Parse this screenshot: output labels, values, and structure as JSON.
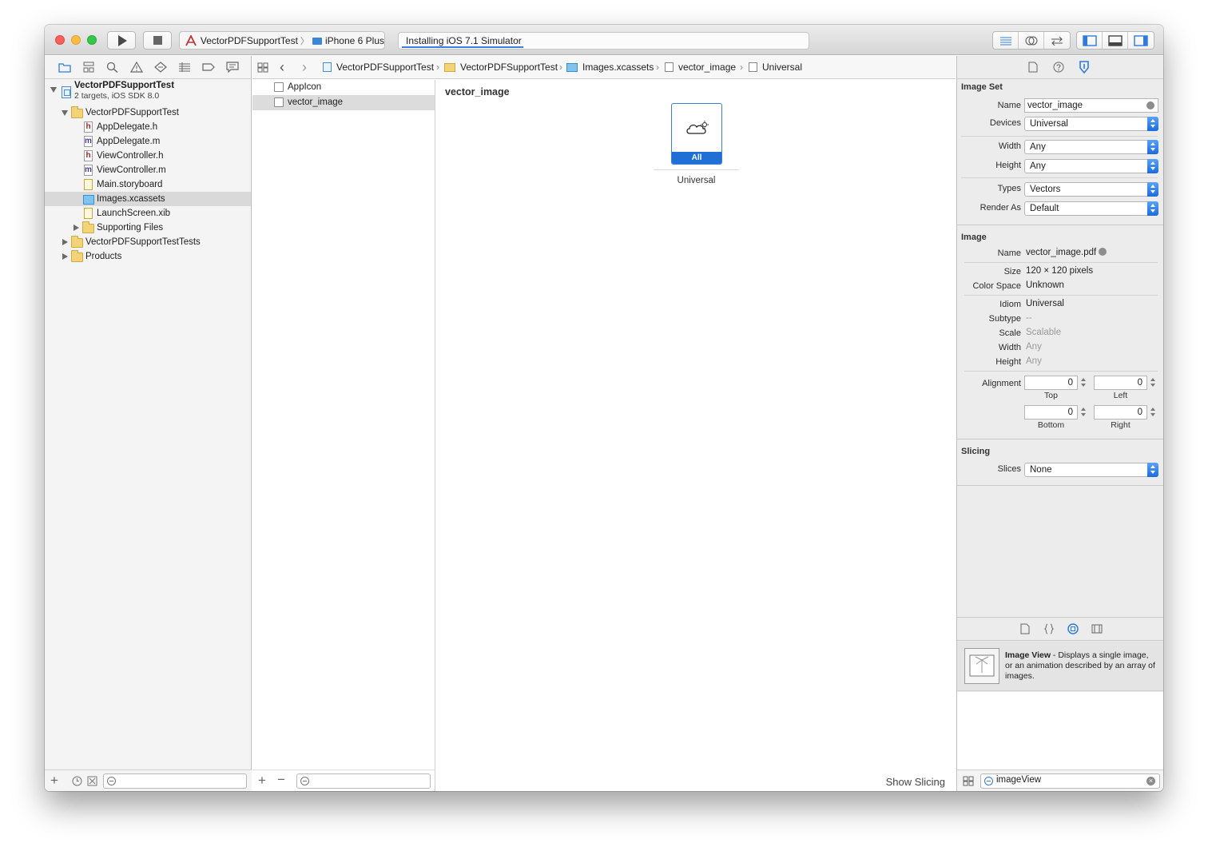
{
  "toolbar": {
    "scheme": "VectorPDFSupportTest",
    "device": "iPhone 6 Plus",
    "activity": "Installing iOS 7.1 Simulator"
  },
  "navigator": {
    "project": {
      "name": "VectorPDFSupportTest",
      "subtitle": "2 targets, iOS SDK 8.0"
    },
    "items": [
      {
        "label": "VectorPDFSupportTest",
        "kind": "folder"
      },
      {
        "label": "AppDelegate.h",
        "kind": "h"
      },
      {
        "label": "AppDelegate.m",
        "kind": "m"
      },
      {
        "label": "ViewController.h",
        "kind": "h"
      },
      {
        "label": "ViewController.m",
        "kind": "m"
      },
      {
        "label": "Main.storyboard",
        "kind": "storyboard"
      },
      {
        "label": "Images.xcassets",
        "kind": "xcassets",
        "selected": true
      },
      {
        "label": "LaunchScreen.xib",
        "kind": "xib"
      },
      {
        "label": "Supporting Files",
        "kind": "folder"
      },
      {
        "label": "VectorPDFSupportTestTests",
        "kind": "folder"
      },
      {
        "label": "Products",
        "kind": "folder"
      }
    ],
    "file_type_glyphs": {
      "h": "h",
      "m": "m"
    }
  },
  "jumpbar": {
    "crumbs": [
      "VectorPDFSupportTest",
      "VectorPDFSupportTest",
      "Images.xcassets",
      "vector_image",
      "Universal"
    ]
  },
  "assets": {
    "items": [
      {
        "label": "AppIcon"
      },
      {
        "label": "vector_image",
        "selected": true
      }
    ]
  },
  "canvas": {
    "title": "vector_image",
    "slot_label": "All",
    "slot_caption": "Universal",
    "show_slicing": "Show Slicing"
  },
  "inspector": {
    "image_set": {
      "title": "Image Set",
      "name_label": "Name",
      "name_value": "vector_image",
      "devices_label": "Devices",
      "devices_value": "Universal",
      "width_label": "Width",
      "width_value": "Any",
      "height_label": "Height",
      "height_value": "Any",
      "types_label": "Types",
      "types_value": "Vectors",
      "render_label": "Render As",
      "render_value": "Default"
    },
    "image": {
      "title": "Image",
      "name_label": "Name",
      "name_value": "vector_image.pdf",
      "size_label": "Size",
      "size_value": "120 × 120 pixels",
      "colorspace_label": "Color Space",
      "colorspace_value": "Unknown",
      "idiom_label": "Idiom",
      "idiom_value": "Universal",
      "subtype_label": "Subtype",
      "subtype_value": "--",
      "scale_label": "Scale",
      "scale_value": "Scalable",
      "width_label": "Width",
      "width_value": "Any",
      "height_label": "Height",
      "height_value": "Any",
      "alignment_label": "Alignment",
      "top_value": "0",
      "top_label": "Top",
      "left_value": "0",
      "left_label": "Left",
      "bottom_value": "0",
      "bottom_label": "Bottom",
      "right_value": "0",
      "right_label": "Right"
    },
    "slicing": {
      "title": "Slicing",
      "slices_label": "Slices",
      "slices_value": "None"
    },
    "library": {
      "item_title": "Image View",
      "item_desc": " - Displays a single image, or an animation described by an array of images.",
      "filter_value": "imageView"
    }
  },
  "colors": {
    "accent": "#1f6fd6",
    "selection": "#d9d9d9"
  }
}
